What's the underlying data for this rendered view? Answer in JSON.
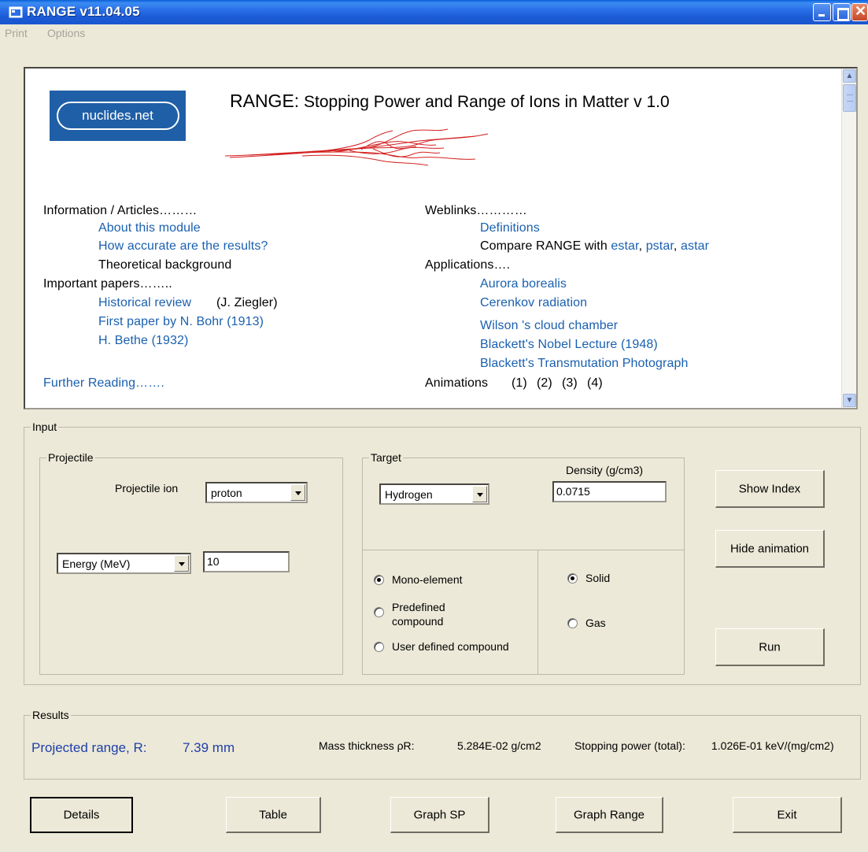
{
  "window": {
    "title": "RANGE v11.04.05"
  },
  "menu": [
    "Print",
    "Options"
  ],
  "info": {
    "logo_text": "nuclides.net",
    "heading_bold": "RANGE:",
    "heading_rest": " Stopping Power and Range of Ions in Matter v 1.0",
    "left": {
      "info_articles": "Information / Articles………",
      "about": "About this module",
      "accuracy": "How accurate are the results?",
      "theory": "Theoretical background",
      "papers": "Important papers……..",
      "historical": "Historical review",
      "historical_author": "(J. Ziegler)",
      "bohr": "First paper by N. Bohr (1913)",
      "bethe": "H. Bethe (1932)",
      "further": "Further Reading……."
    },
    "right": {
      "weblinks": "Weblinks…………",
      "definitions": "Definitions",
      "compare_prefix": "Compare RANGE with ",
      "estar": "estar",
      "pstar": "pstar",
      "astar": "astar",
      "applications": "Applications….",
      "aurora": "Aurora borealis",
      "cerenkov": "Cerenkov radiation",
      "wilson": "Wilson 's cloud chamber",
      "blackett_nobel": "Blackett's Nobel Lecture (1948)",
      "blackett_photo": "Blackett's Transmutation Photograph",
      "animations": "Animations",
      "anim_links": [
        "(1)",
        "(2)",
        "(3)",
        "(4)"
      ]
    }
  },
  "input": {
    "legend": "Input",
    "projectile": {
      "legend": "Projectile",
      "ion_label": "Projectile ion",
      "ion_value": "proton",
      "mode_value": "Energy (MeV)",
      "energy_value": "10"
    },
    "target": {
      "legend": "Target",
      "element_value": "Hydrogen",
      "density_label": "Density (g/cm3)",
      "density_value": "0.0715",
      "types": [
        "Mono-element",
        "Predefined compound",
        "User defined compound"
      ],
      "type_line1": "Predefined",
      "type_line2": "compound",
      "selected_type": "Mono-element",
      "states": [
        "Solid",
        "Gas"
      ],
      "selected_state": "Solid"
    },
    "buttons": {
      "show_index": "Show Index",
      "hide_animation": "Hide animation",
      "run": "Run"
    }
  },
  "results": {
    "legend": "Results",
    "range_label": "Projected range, R:",
    "range_value": "7.39 mm",
    "mass_label": "Mass thickness ρR:",
    "mass_value": "5.284E-02  g/cm2",
    "sp_label": "Stopping power (total):",
    "sp_value": "1.026E-01  keV/(mg/cm2)"
  },
  "bottom_buttons": {
    "details": "Details",
    "table": "Table",
    "graph_sp": "Graph SP",
    "graph_range": "Graph Range",
    "exit": "Exit"
  },
  "colors": {
    "titlebar": "#2a6fe8",
    "link": "#1a60b0",
    "result_highlight": "#1f3fa8",
    "scribble": "#d42020"
  }
}
